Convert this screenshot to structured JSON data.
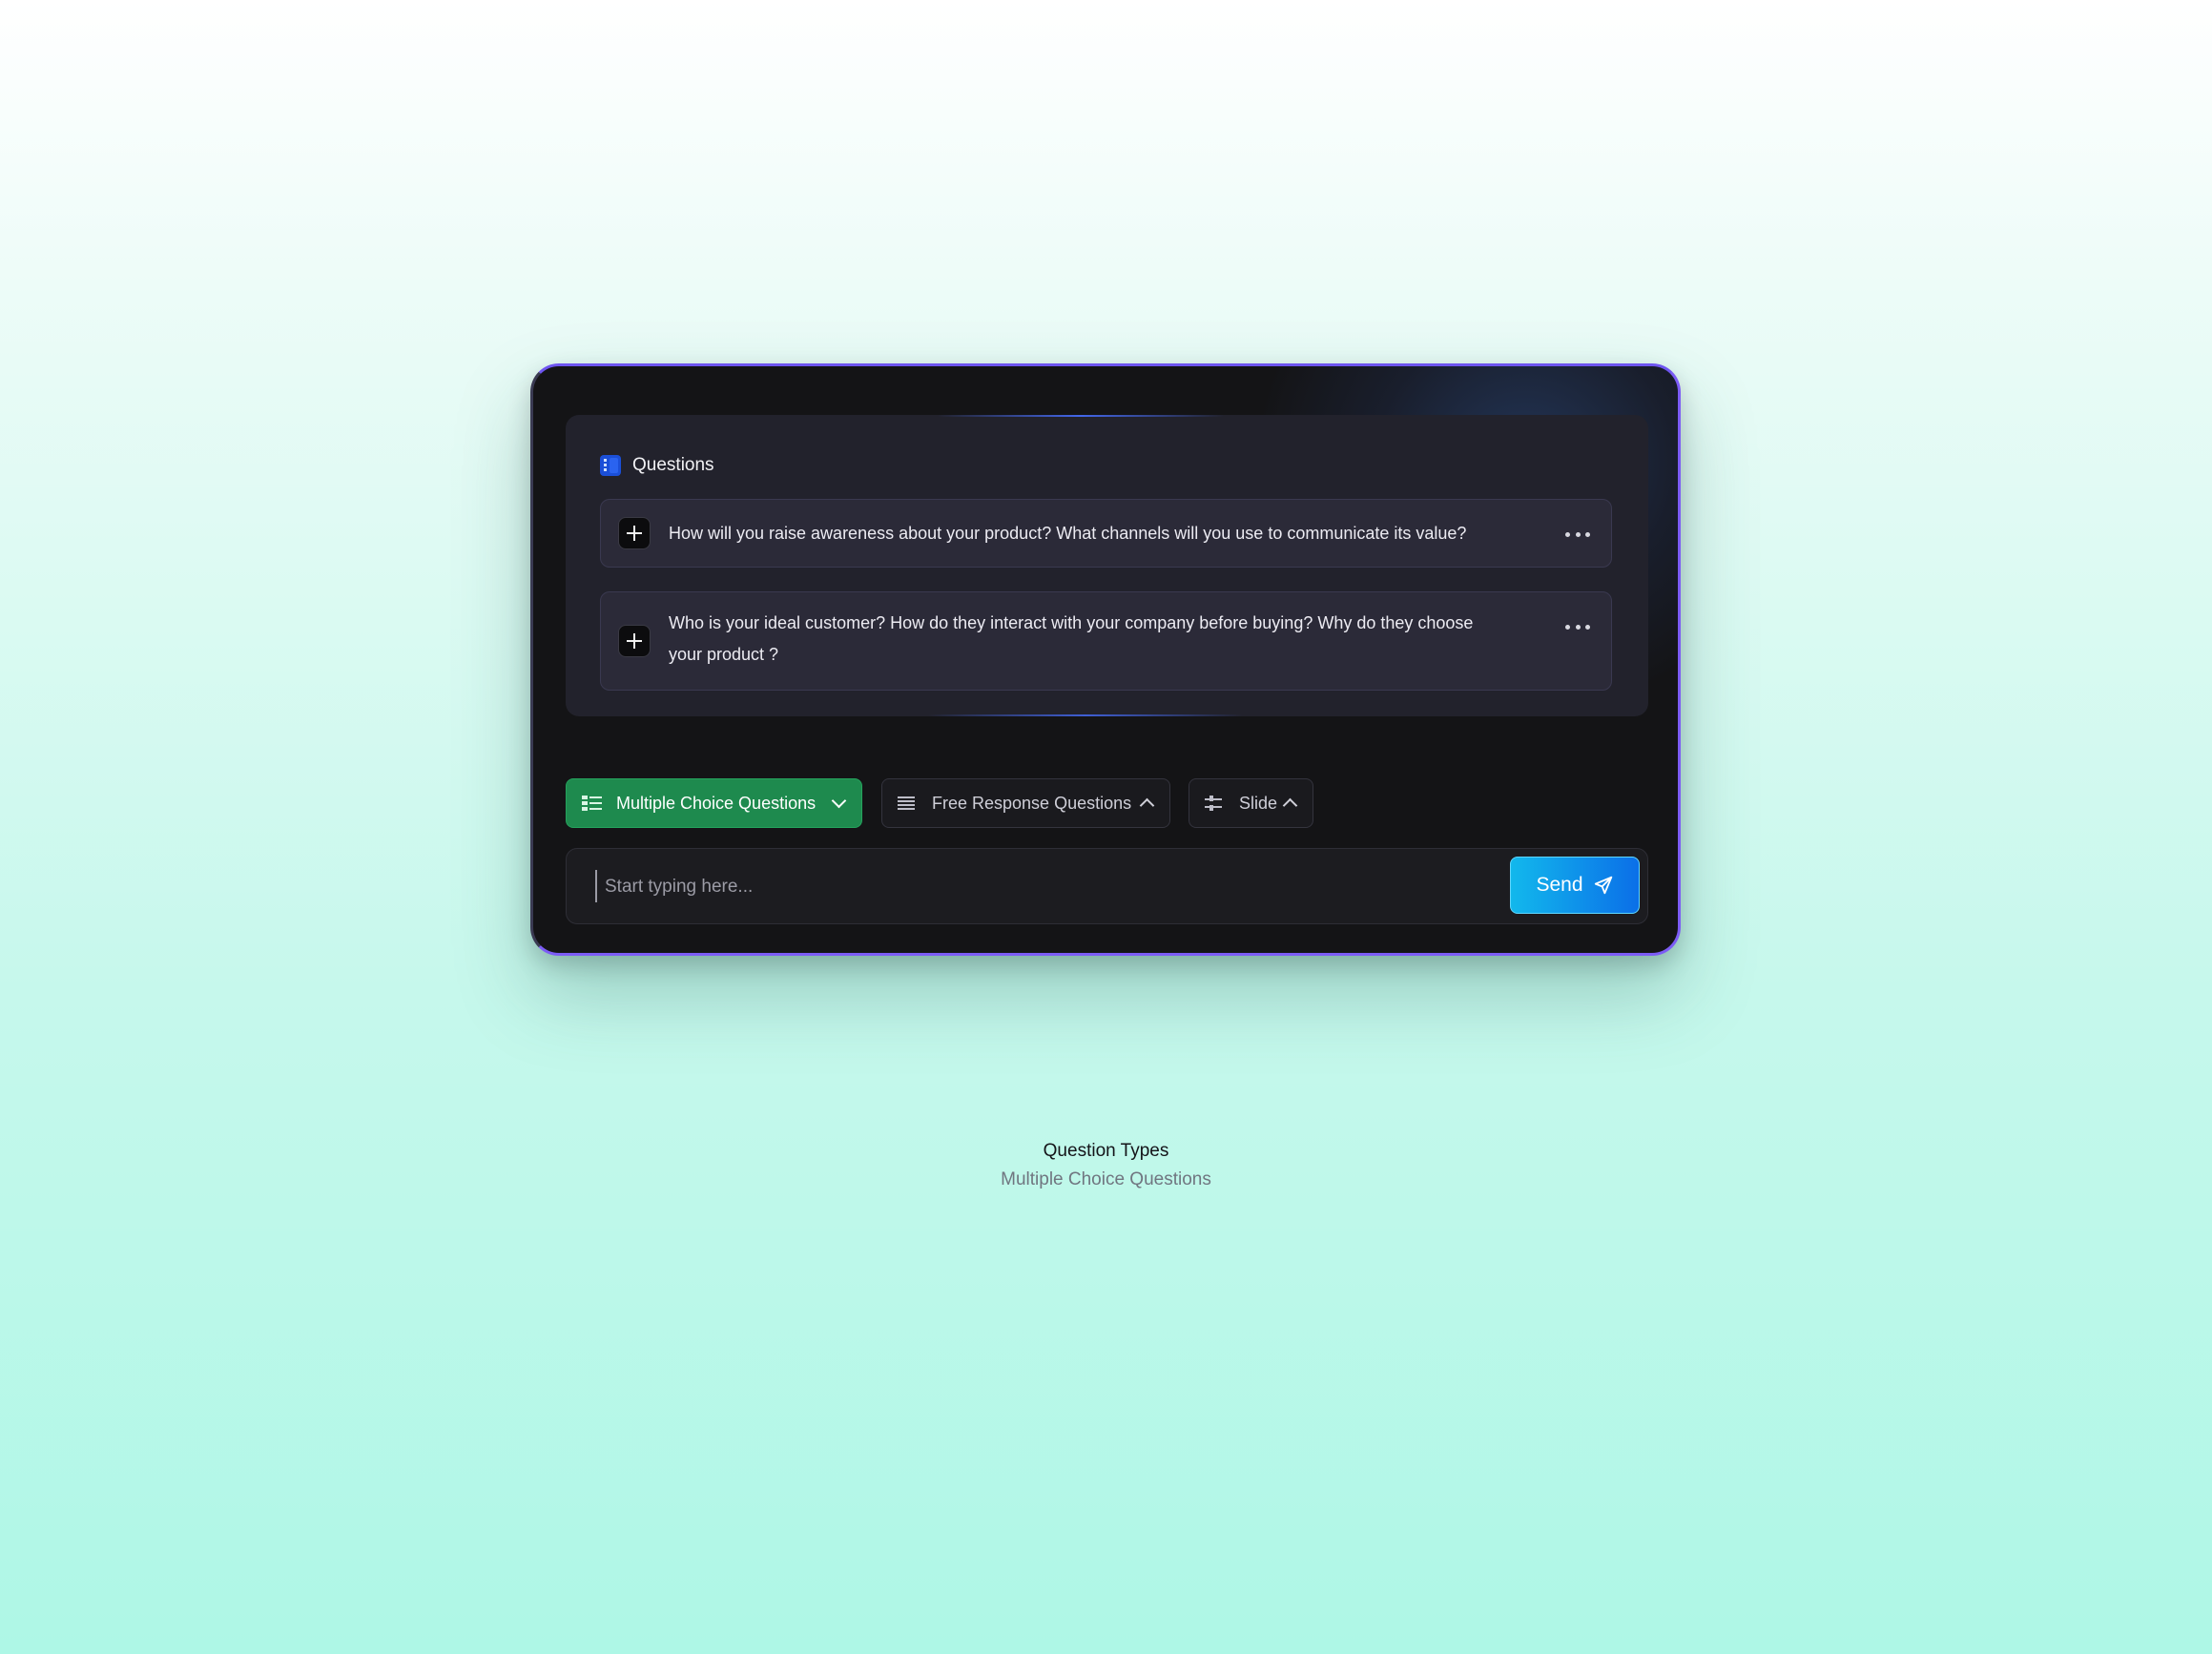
{
  "panel": {
    "title": "Questions",
    "questions": [
      {
        "text": "How will you raise awareness about your product? What channels will you use to communicate its value?"
      },
      {
        "text": "Who is your ideal customer?  How do they interact with your company before buying? Why do they choose your product ?"
      }
    ]
  },
  "types": {
    "mcq": "Multiple Choice Questions",
    "frq": "Free Response Questions",
    "slide": "Slide"
  },
  "input": {
    "placeholder": "Start typing here...",
    "send_label": "Send"
  },
  "caption": {
    "title": "Question Types",
    "subtitle": "Multiple Choice Questions"
  },
  "colors": {
    "accent_green": "#1e8a4e",
    "send_gradient_start": "#12b8ec",
    "send_gradient_end": "#0b6fe8",
    "card_border": "#7c5cf5"
  },
  "icons": {
    "panel": "document-icon",
    "question_action": "plus-icon",
    "question_menu": "more-horizontal-icon",
    "mcq": "list-choice-icon",
    "frq": "text-lines-icon",
    "slide": "sliders-icon",
    "send": "paper-plane-icon"
  }
}
